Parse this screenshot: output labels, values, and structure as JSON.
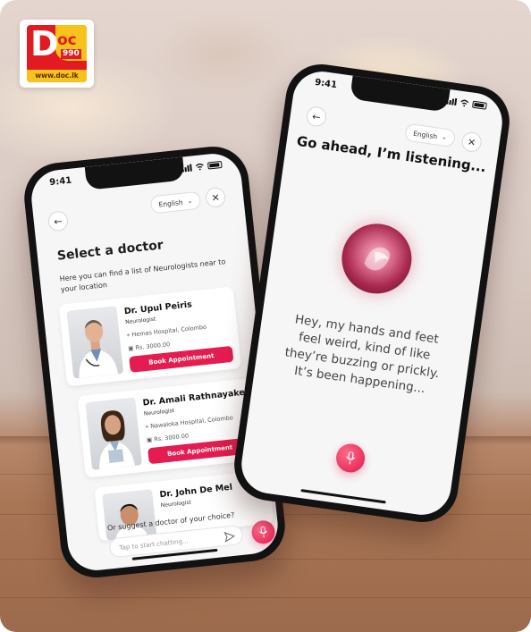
{
  "logo": {
    "main": "D",
    "suffix": "oc",
    "number": "990",
    "url": "www.doc.lk"
  },
  "left_phone": {
    "status_time": "9:41",
    "language": "English",
    "title": "Select a doctor",
    "subtitle": "Here you can find a list of Neurologists near to your location",
    "doctors": [
      {
        "name": "Dr. Upul Peiris",
        "specialty": "Neurologist",
        "hospital": "Hemas Hospital, Colombo",
        "fee": "Rs. 3000.00",
        "button": "Book Appointment"
      },
      {
        "name": "Dr. Amali Rathnayake",
        "specialty": "Neurologist",
        "hospital": "Nawaloka Hospital, Colombo",
        "fee": "Rs. 3000.00",
        "button": "Book Appointment"
      },
      {
        "name": "Dr. John De Mel",
        "specialty": "Neurologist"
      }
    ],
    "suggest_label": "Or suggest a doctor of your choice?",
    "chat_placeholder": "Tap to start chatting..."
  },
  "right_phone": {
    "status_time": "9:41",
    "language": "English",
    "heading": "Go ahead, I’m listening...",
    "transcript": "Hey, my hands and feet feel weird, kind of like they’re buzzing or prickly. It’s been happening..."
  },
  "colors": {
    "accent": "#e51c4f",
    "logo_red": "#e21b23",
    "logo_yellow": "#f7c21b"
  },
  "icons": [
    "back-arrow-icon",
    "close-icon",
    "chevron-down-icon",
    "location-pin-icon",
    "money-icon",
    "send-icon",
    "mic-icon",
    "signal-icon",
    "wifi-icon",
    "battery-icon"
  ]
}
